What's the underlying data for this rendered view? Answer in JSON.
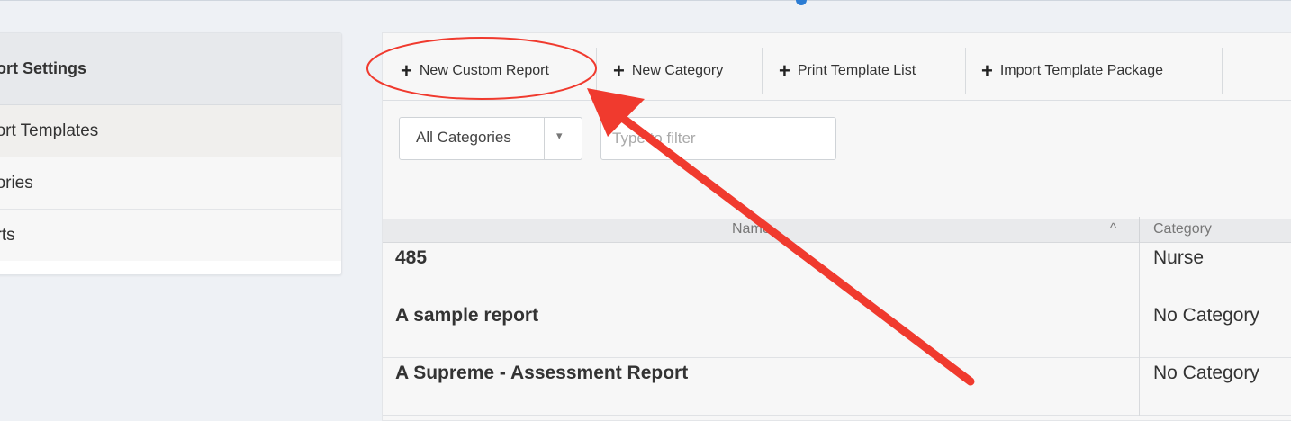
{
  "sidebar": {
    "header": "port Settings",
    "items": [
      {
        "label": "port Templates"
      },
      {
        "label": "gories"
      },
      {
        "label": "orts"
      }
    ]
  },
  "toolbar": {
    "buttons": [
      {
        "label": "New Custom Report",
        "icon": "plus-icon"
      },
      {
        "label": "New Category",
        "icon": "plus-icon"
      },
      {
        "label": "Print Template List",
        "icon": "plus-icon"
      },
      {
        "label": "Import Template Package",
        "icon": "plus-icon"
      }
    ],
    "plus_glyph": "+"
  },
  "filters": {
    "category_select": "All Categories",
    "caret": "▾",
    "search_placeholder": "Type to filter"
  },
  "table": {
    "columns": {
      "name": "Name",
      "category": "Category"
    },
    "sort_glyph": "^",
    "rows": [
      {
        "name": "485",
        "category": "Nurse"
      },
      {
        "name": "A sample report",
        "category": "No Category"
      },
      {
        "name": "A Supreme - Assessment Report",
        "category": "No Category"
      }
    ]
  },
  "annotation": {
    "color": "#f03a2e"
  }
}
